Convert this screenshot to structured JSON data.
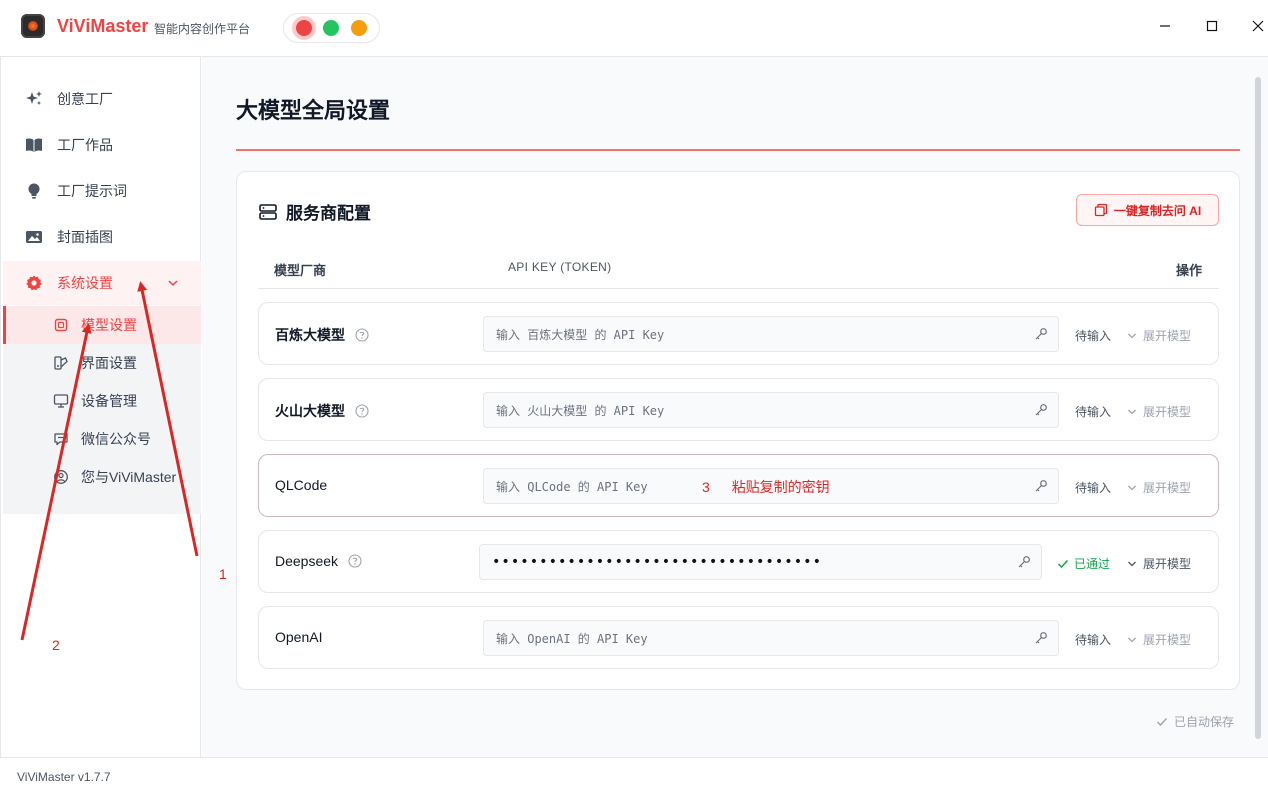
{
  "app": {
    "name": "ViViMaster",
    "subtitle": "智能内容创作平台",
    "version": "ViViMaster v1.7.7"
  },
  "window_controls": {
    "minimize": "—",
    "maximize": "☐",
    "close": "✕"
  },
  "sidebar": {
    "items": [
      {
        "label": "创意工厂",
        "icon": "sparkles-icon"
      },
      {
        "label": "工厂作品",
        "icon": "book-icon"
      },
      {
        "label": "工厂提示词",
        "icon": "lightbulb-icon"
      },
      {
        "label": "封面插图",
        "icon": "image-icon"
      },
      {
        "label": "系统设置",
        "icon": "gear-icon",
        "active": true,
        "expanded": true
      }
    ],
    "sub_items": [
      {
        "label": "模型设置",
        "icon": "chip-icon",
        "active": true
      },
      {
        "label": "界面设置",
        "icon": "palette-icon"
      },
      {
        "label": "设备管理",
        "icon": "monitor-icon"
      },
      {
        "label": "微信公众号",
        "icon": "chat-icon"
      },
      {
        "label": "您与ViViMaster",
        "icon": "user-circle-icon"
      }
    ]
  },
  "main": {
    "title": "大模型全局设置",
    "card": {
      "title": "服务商配置",
      "copy_button": "一键复制去问 AI",
      "columns": {
        "vendor": "模型厂商",
        "api_key": "API KEY (TOKEN)",
        "action": "操作"
      },
      "providers": [
        {
          "name": "百炼大模型",
          "placeholder": "输入 百炼大模型 的 API Key",
          "value": "",
          "status": "待输入",
          "expand": "展开模型",
          "help": true
        },
        {
          "name": "火山大模型",
          "placeholder": "输入 火山大模型 的 API Key",
          "value": "",
          "status": "待输入",
          "expand": "展开模型",
          "help": true
        },
        {
          "name": "QLCode",
          "placeholder": "输入 QLCode 的 API Key",
          "value": "",
          "status": "待输入",
          "expand": "展开模型",
          "help": false
        },
        {
          "name": "Deepseek",
          "placeholder": "",
          "value": "•••••••••••••••••••••••••••••••••••",
          "status": "已通过",
          "expand": "展开模型",
          "help": true
        },
        {
          "name": "OpenAI",
          "placeholder": "输入 OpenAI 的 API Key",
          "value": "",
          "status": "待输入",
          "expand": "展开模型",
          "help": false
        }
      ]
    },
    "autosave": "已自动保存"
  },
  "annotations": {
    "label_1": "1",
    "label_2": "2",
    "label_3": "3",
    "hint_3": "粘贴复制的密钥",
    "color": "#dc2626"
  },
  "colors": {
    "accent": "#ef4444",
    "success": "#16a34a"
  }
}
